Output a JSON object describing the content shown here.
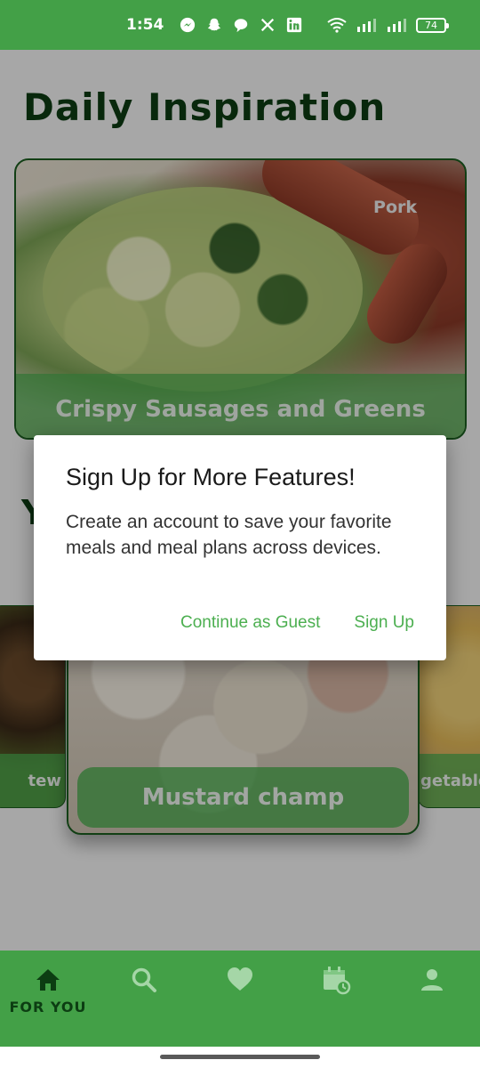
{
  "status_bar": {
    "time": "1:54",
    "notification_icons": [
      "messenger-icon",
      "snapchat-icon",
      "chat-bubble-icon",
      "x-icon",
      "linkedin-icon"
    ],
    "battery": "74"
  },
  "page": {
    "title": "Daily Inspiration"
  },
  "hero": {
    "tag": "Pork",
    "title": "Crispy Sausages and Greens"
  },
  "section": {
    "heading_visible": "Y"
  },
  "carousel": {
    "left_caption": "tew",
    "center_caption": "Mustard champ",
    "right_caption": "getable"
  },
  "dialog": {
    "title": "Sign Up for More Features!",
    "body": "Create an account to save your favorite meals and meal plans across devices.",
    "continue_label": "Continue as Guest",
    "signup_label": "Sign Up"
  },
  "bottom_nav": {
    "items": [
      {
        "icon": "home-icon",
        "label": "FOR YOU",
        "active": true
      },
      {
        "icon": "search-icon",
        "label": "",
        "active": false
      },
      {
        "icon": "heart-icon",
        "label": "",
        "active": false
      },
      {
        "icon": "calendar-clock-icon",
        "label": "",
        "active": false
      },
      {
        "icon": "person-icon",
        "label": "",
        "active": false
      }
    ]
  },
  "colors": {
    "brand_green": "#43a047",
    "title_green": "#0c3d12",
    "accent_button": "#4caf50"
  }
}
